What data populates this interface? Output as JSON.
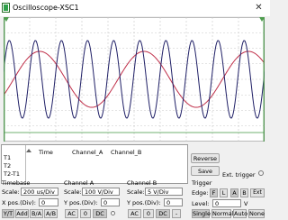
{
  "window": {
    "title": "Oscilloscope-XSC1",
    "close_glyph": "✕"
  },
  "colors": {
    "channel_a": "#c0304a",
    "channel_b": "#1f1f66",
    "grid": "#c8c8c8",
    "screen_bg": "#ffffff",
    "marker": "#4e9d4e"
  },
  "readout": {
    "columns": [
      "Time",
      "Channel_A",
      "Channel_B"
    ],
    "rows": [
      "T1",
      "T2",
      "T2-T1"
    ]
  },
  "buttons": {
    "reverse": "Reverse",
    "save": "Save",
    "ext_trigger": "Ext. trigger"
  },
  "timebase": {
    "header": "Timebase",
    "scale_label": "Scale:",
    "scale_value": "200 us/Div",
    "xpos_label": "X pos.(Div):",
    "xpos_value": "0",
    "modes": [
      "Y/T",
      "Add",
      "B/A",
      "A/B"
    ]
  },
  "channel_a": {
    "header": "Channel A",
    "scale_label": "Scale:",
    "scale_value": "100  V/Div",
    "ypos_label": "Y pos.(Div):",
    "ypos_value": "0",
    "coupling": [
      "AC",
      "0",
      "DC"
    ]
  },
  "channel_b": {
    "header": "Channel B",
    "scale_label": "Scale:",
    "scale_value": "5  V/Div",
    "ypos_label": "Y pos.(Div):",
    "ypos_value": "0",
    "coupling": [
      "AC",
      "0",
      "DC",
      "-"
    ]
  },
  "trigger": {
    "header": "Trigger",
    "edge_label": "Edge:",
    "edge_buttons": [
      "F",
      "L",
      "A",
      "B",
      "Ext"
    ],
    "level_label": "Level:",
    "level_value": "0",
    "level_unit": "V",
    "modes": [
      "Single",
      "Normal",
      "Auto",
      "None"
    ]
  },
  "traces": {
    "channel_a": {
      "cycles_visible": 2.5,
      "amplitude_div": 1.8
    },
    "channel_b": {
      "cycles_visible": 10,
      "amplitude_div": 2.5
    }
  }
}
